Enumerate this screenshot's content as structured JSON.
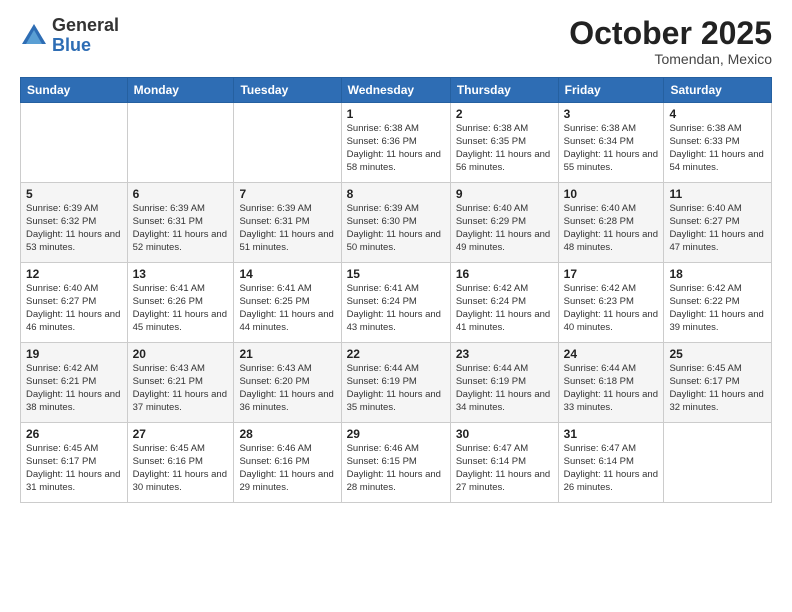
{
  "logo": {
    "general": "General",
    "blue": "Blue"
  },
  "header": {
    "month": "October 2025",
    "location": "Tomendan, Mexico"
  },
  "weekdays": [
    "Sunday",
    "Monday",
    "Tuesday",
    "Wednesday",
    "Thursday",
    "Friday",
    "Saturday"
  ],
  "weeks": [
    [
      {
        "day": "",
        "sunrise": "",
        "sunset": "",
        "daylight": ""
      },
      {
        "day": "",
        "sunrise": "",
        "sunset": "",
        "daylight": ""
      },
      {
        "day": "",
        "sunrise": "",
        "sunset": "",
        "daylight": ""
      },
      {
        "day": "1",
        "sunrise": "Sunrise: 6:38 AM",
        "sunset": "Sunset: 6:36 PM",
        "daylight": "Daylight: 11 hours and 58 minutes."
      },
      {
        "day": "2",
        "sunrise": "Sunrise: 6:38 AM",
        "sunset": "Sunset: 6:35 PM",
        "daylight": "Daylight: 11 hours and 56 minutes."
      },
      {
        "day": "3",
        "sunrise": "Sunrise: 6:38 AM",
        "sunset": "Sunset: 6:34 PM",
        "daylight": "Daylight: 11 hours and 55 minutes."
      },
      {
        "day": "4",
        "sunrise": "Sunrise: 6:38 AM",
        "sunset": "Sunset: 6:33 PM",
        "daylight": "Daylight: 11 hours and 54 minutes."
      }
    ],
    [
      {
        "day": "5",
        "sunrise": "Sunrise: 6:39 AM",
        "sunset": "Sunset: 6:32 PM",
        "daylight": "Daylight: 11 hours and 53 minutes."
      },
      {
        "day": "6",
        "sunrise": "Sunrise: 6:39 AM",
        "sunset": "Sunset: 6:31 PM",
        "daylight": "Daylight: 11 hours and 52 minutes."
      },
      {
        "day": "7",
        "sunrise": "Sunrise: 6:39 AM",
        "sunset": "Sunset: 6:31 PM",
        "daylight": "Daylight: 11 hours and 51 minutes."
      },
      {
        "day": "8",
        "sunrise": "Sunrise: 6:39 AM",
        "sunset": "Sunset: 6:30 PM",
        "daylight": "Daylight: 11 hours and 50 minutes."
      },
      {
        "day": "9",
        "sunrise": "Sunrise: 6:40 AM",
        "sunset": "Sunset: 6:29 PM",
        "daylight": "Daylight: 11 hours and 49 minutes."
      },
      {
        "day": "10",
        "sunrise": "Sunrise: 6:40 AM",
        "sunset": "Sunset: 6:28 PM",
        "daylight": "Daylight: 11 hours and 48 minutes."
      },
      {
        "day": "11",
        "sunrise": "Sunrise: 6:40 AM",
        "sunset": "Sunset: 6:27 PM",
        "daylight": "Daylight: 11 hours and 47 minutes."
      }
    ],
    [
      {
        "day": "12",
        "sunrise": "Sunrise: 6:40 AM",
        "sunset": "Sunset: 6:27 PM",
        "daylight": "Daylight: 11 hours and 46 minutes."
      },
      {
        "day": "13",
        "sunrise": "Sunrise: 6:41 AM",
        "sunset": "Sunset: 6:26 PM",
        "daylight": "Daylight: 11 hours and 45 minutes."
      },
      {
        "day": "14",
        "sunrise": "Sunrise: 6:41 AM",
        "sunset": "Sunset: 6:25 PM",
        "daylight": "Daylight: 11 hours and 44 minutes."
      },
      {
        "day": "15",
        "sunrise": "Sunrise: 6:41 AM",
        "sunset": "Sunset: 6:24 PM",
        "daylight": "Daylight: 11 hours and 43 minutes."
      },
      {
        "day": "16",
        "sunrise": "Sunrise: 6:42 AM",
        "sunset": "Sunset: 6:24 PM",
        "daylight": "Daylight: 11 hours and 41 minutes."
      },
      {
        "day": "17",
        "sunrise": "Sunrise: 6:42 AM",
        "sunset": "Sunset: 6:23 PM",
        "daylight": "Daylight: 11 hours and 40 minutes."
      },
      {
        "day": "18",
        "sunrise": "Sunrise: 6:42 AM",
        "sunset": "Sunset: 6:22 PM",
        "daylight": "Daylight: 11 hours and 39 minutes."
      }
    ],
    [
      {
        "day": "19",
        "sunrise": "Sunrise: 6:42 AM",
        "sunset": "Sunset: 6:21 PM",
        "daylight": "Daylight: 11 hours and 38 minutes."
      },
      {
        "day": "20",
        "sunrise": "Sunrise: 6:43 AM",
        "sunset": "Sunset: 6:21 PM",
        "daylight": "Daylight: 11 hours and 37 minutes."
      },
      {
        "day": "21",
        "sunrise": "Sunrise: 6:43 AM",
        "sunset": "Sunset: 6:20 PM",
        "daylight": "Daylight: 11 hours and 36 minutes."
      },
      {
        "day": "22",
        "sunrise": "Sunrise: 6:44 AM",
        "sunset": "Sunset: 6:19 PM",
        "daylight": "Daylight: 11 hours and 35 minutes."
      },
      {
        "day": "23",
        "sunrise": "Sunrise: 6:44 AM",
        "sunset": "Sunset: 6:19 PM",
        "daylight": "Daylight: 11 hours and 34 minutes."
      },
      {
        "day": "24",
        "sunrise": "Sunrise: 6:44 AM",
        "sunset": "Sunset: 6:18 PM",
        "daylight": "Daylight: 11 hours and 33 minutes."
      },
      {
        "day": "25",
        "sunrise": "Sunrise: 6:45 AM",
        "sunset": "Sunset: 6:17 PM",
        "daylight": "Daylight: 11 hours and 32 minutes."
      }
    ],
    [
      {
        "day": "26",
        "sunrise": "Sunrise: 6:45 AM",
        "sunset": "Sunset: 6:17 PM",
        "daylight": "Daylight: 11 hours and 31 minutes."
      },
      {
        "day": "27",
        "sunrise": "Sunrise: 6:45 AM",
        "sunset": "Sunset: 6:16 PM",
        "daylight": "Daylight: 11 hours and 30 minutes."
      },
      {
        "day": "28",
        "sunrise": "Sunrise: 6:46 AM",
        "sunset": "Sunset: 6:16 PM",
        "daylight": "Daylight: 11 hours and 29 minutes."
      },
      {
        "day": "29",
        "sunrise": "Sunrise: 6:46 AM",
        "sunset": "Sunset: 6:15 PM",
        "daylight": "Daylight: 11 hours and 28 minutes."
      },
      {
        "day": "30",
        "sunrise": "Sunrise: 6:47 AM",
        "sunset": "Sunset: 6:14 PM",
        "daylight": "Daylight: 11 hours and 27 minutes."
      },
      {
        "day": "31",
        "sunrise": "Sunrise: 6:47 AM",
        "sunset": "Sunset: 6:14 PM",
        "daylight": "Daylight: 11 hours and 26 minutes."
      },
      {
        "day": "",
        "sunrise": "",
        "sunset": "",
        "daylight": ""
      }
    ]
  ]
}
